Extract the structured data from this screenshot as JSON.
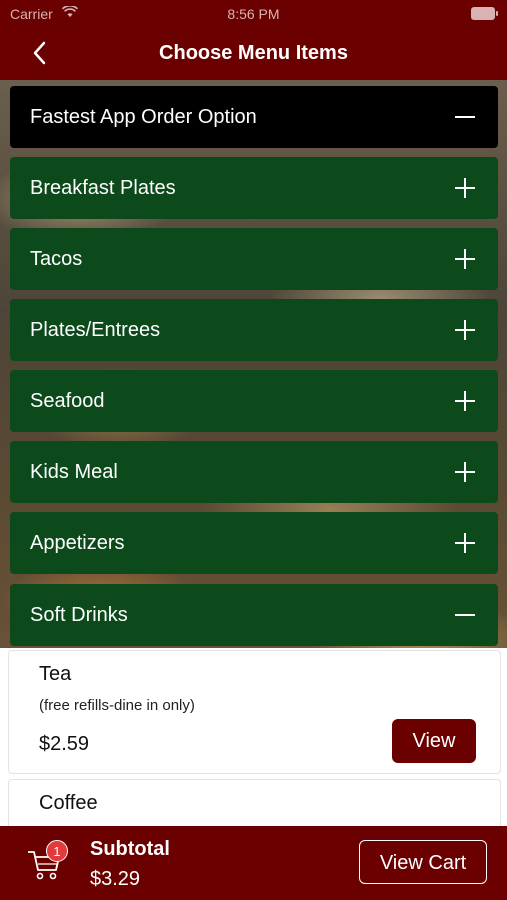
{
  "status": {
    "carrier": "Carrier",
    "time": "8:56 PM"
  },
  "nav": {
    "title": "Choose Menu Items"
  },
  "sections": [
    {
      "label": "Fastest App Order Option",
      "state": "expanded"
    },
    {
      "label": "Breakfast Plates",
      "state": "collapsed"
    },
    {
      "label": "Tacos",
      "state": "collapsed"
    },
    {
      "label": "Plates/Entrees",
      "state": "collapsed"
    },
    {
      "label": "Seafood",
      "state": "collapsed"
    },
    {
      "label": "Kids Meal",
      "state": "collapsed"
    },
    {
      "label": "Appetizers",
      "state": "collapsed"
    },
    {
      "label": "Soft Drinks",
      "state": "expanded"
    }
  ],
  "items": [
    {
      "name": "Tea",
      "description": "(free refills-dine in only)",
      "price": "$2.59",
      "button": "View"
    },
    {
      "name": "Coffee"
    }
  ],
  "footer": {
    "badge": "1",
    "subtotal_label": "Subtotal",
    "subtotal_value": "$3.29",
    "view_cart": "View Cart"
  },
  "colors": {
    "brand": "#6b0000",
    "section_green": "#0c4a1c",
    "section_black": "#000000"
  }
}
